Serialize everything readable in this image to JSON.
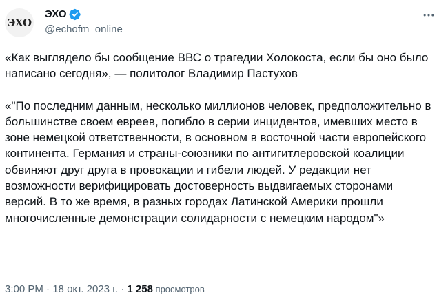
{
  "author": {
    "avatar_text": "ЭХО",
    "display_name": "ЭХО",
    "handle": "@echofm_online",
    "verified_color": "#1d9bf0"
  },
  "tweet": {
    "paragraph_1": "«Как выглядело бы сообщение ВВС о трагедии Холокоста, если бы оно было написано сегодня», — политолог Владимир Пастухов",
    "paragraph_2": "«\"По последним данным, несколько миллионов человек, предположительно в большинстве своем евреев, погибло в серии инцидентов, имевших место в зоне немецкой ответственности, в основном в восточной части европейского континента. Германия и страны-союзники по антигитлеровской коалиции обвиняют друг друга в провокации и гибели людей. У редакции нет возможности верифицировать достоверность выдвигаемых сторонами версий. В то же время, в разных городах Латинской Америки прошли многочисленные демонстрации солидарности с немецким народом\"»"
  },
  "meta": {
    "time": "3:00 PM",
    "separator": " · ",
    "date": "18 окт. 2023 г.",
    "views_count": "1 258",
    "views_label": " просмотров"
  },
  "icons": {
    "more": "more-horizontal-icon",
    "verified": "verified-badge-icon"
  }
}
